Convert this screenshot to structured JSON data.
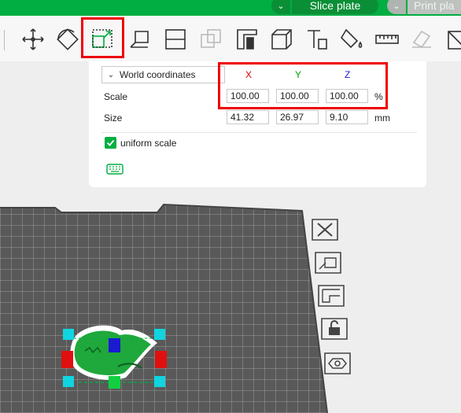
{
  "topbar": {
    "slice_arrow": "⌄",
    "slice_label": "Slice plate",
    "print_arrow": "⌄",
    "print_label": "Print pla"
  },
  "panel": {
    "coordinate_system": "World coordinates",
    "axes": {
      "x": "X",
      "y": "Y",
      "z": "Z"
    },
    "axis_colors": {
      "x": "#e00000",
      "y": "#00a000",
      "z": "#1a1ad0"
    },
    "scale": {
      "label": "Scale",
      "x": "100.00",
      "y": "100.00",
      "z": "100.00",
      "unit": "%"
    },
    "size": {
      "label": "Size",
      "x": "41.32",
      "y": "26.97",
      "z": "9.10",
      "unit": "mm"
    },
    "uniform_scale": {
      "label": "uniform scale",
      "checked": true
    }
  },
  "colors": {
    "accent": "#00ae42",
    "highlight": "#e00000",
    "bed": "#5a5a5a"
  }
}
